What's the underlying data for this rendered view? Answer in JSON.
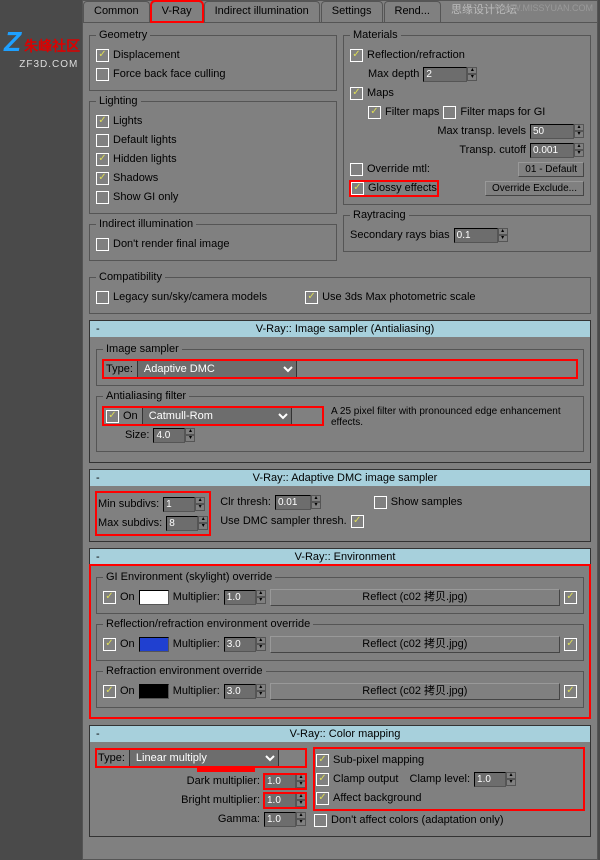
{
  "watermark": "WWW.MISSYUAN.COM",
  "watermark2": "思缘设计论坛",
  "logo": {
    "z": "Z",
    "t1": "朱峰社区",
    "t2": "ZF3D.COM"
  },
  "tabs": {
    "common": "Common",
    "vray": "V-Ray",
    "indirect": "Indirect illumination",
    "settings": "Settings",
    "render": "Rend..."
  },
  "geometry": {
    "legend": "Geometry",
    "displacement": "Displacement",
    "force_back": "Force back face culling"
  },
  "lighting": {
    "legend": "Lighting",
    "lights": "Lights",
    "default": "Default lights",
    "hidden": "Hidden lights",
    "shadows": "Shadows",
    "showgi": "Show GI only"
  },
  "indirect_ill": {
    "legend": "Indirect illumination",
    "dontrender": "Don't render final image"
  },
  "compat": {
    "legend": "Compatibility",
    "legacy": "Legacy sun/sky/camera models",
    "use3ds": "Use 3ds Max photometric scale"
  },
  "materials": {
    "legend": "Materials",
    "refl": "Reflection/refraction",
    "maxdepth": "Max depth",
    "maxdepth_v": "2",
    "maps": "Maps",
    "filtermaps": "Filter maps",
    "filtergi": "Filter maps for GI",
    "transp": "Max transp. levels",
    "transp_v": "50",
    "cutoff": "Transp. cutoff",
    "cutoff_v": "0.001",
    "override": "Override mtl:",
    "override_btn": "01 - Default",
    "glossy": "Glossy effects",
    "exclude": "Override Exclude..."
  },
  "raytracing": {
    "legend": "Raytracing",
    "bias": "Secondary rays bias",
    "bias_v": "0.1"
  },
  "sampler": {
    "title": "V-Ray:: Image sampler (Antialiasing)",
    "img_legend": "Image sampler",
    "type": "Type:",
    "type_v": "Adaptive DMC",
    "aa_legend": "Antialiasing filter",
    "on": "On",
    "filter_v": "Catmull-Rom",
    "size": "Size:",
    "size_v": "4.0",
    "desc": "A 25 pixel filter with pronounced edge enhancement effects."
  },
  "dmc": {
    "title": "V-Ray:: Adaptive DMC image sampler",
    "min": "Min subdivs:",
    "min_v": "1",
    "max": "Max subdivs:",
    "max_v": "8",
    "clr": "Clr thresh:",
    "clr_v": "0.01",
    "usedmc": "Use DMC sampler thresh.",
    "show": "Show samples"
  },
  "env": {
    "title": "V-Ray:: Environment",
    "gi_legend": "GI Environment (skylight) override",
    "refl_legend": "Reflection/refraction environment override",
    "refr_legend": "Refraction environment override",
    "on": "On",
    "mult": "Multiplier:",
    "gi_mult": "1.0",
    "refl_mult": "3.0",
    "refr_mult": "3.0",
    "map": "Reflect (c02 拷贝.jpg)"
  },
  "colormap": {
    "title": "V-Ray:: Color mapping",
    "type": "Type:",
    "type_v": "Linear multiply",
    "dark": "Dark multiplier:",
    "dark_v": "1.0",
    "bright": "Bright multiplier:",
    "bright_v": "1.0",
    "gamma": "Gamma:",
    "gamma_v": "1.0",
    "sub": "Sub-pixel mapping",
    "clamp": "Clamp output",
    "clamplvl": "Clamp level:",
    "clamplvl_v": "1.0",
    "affect": "Affect background",
    "dontaffect": "Don't affect colors (adaptation only)"
  }
}
